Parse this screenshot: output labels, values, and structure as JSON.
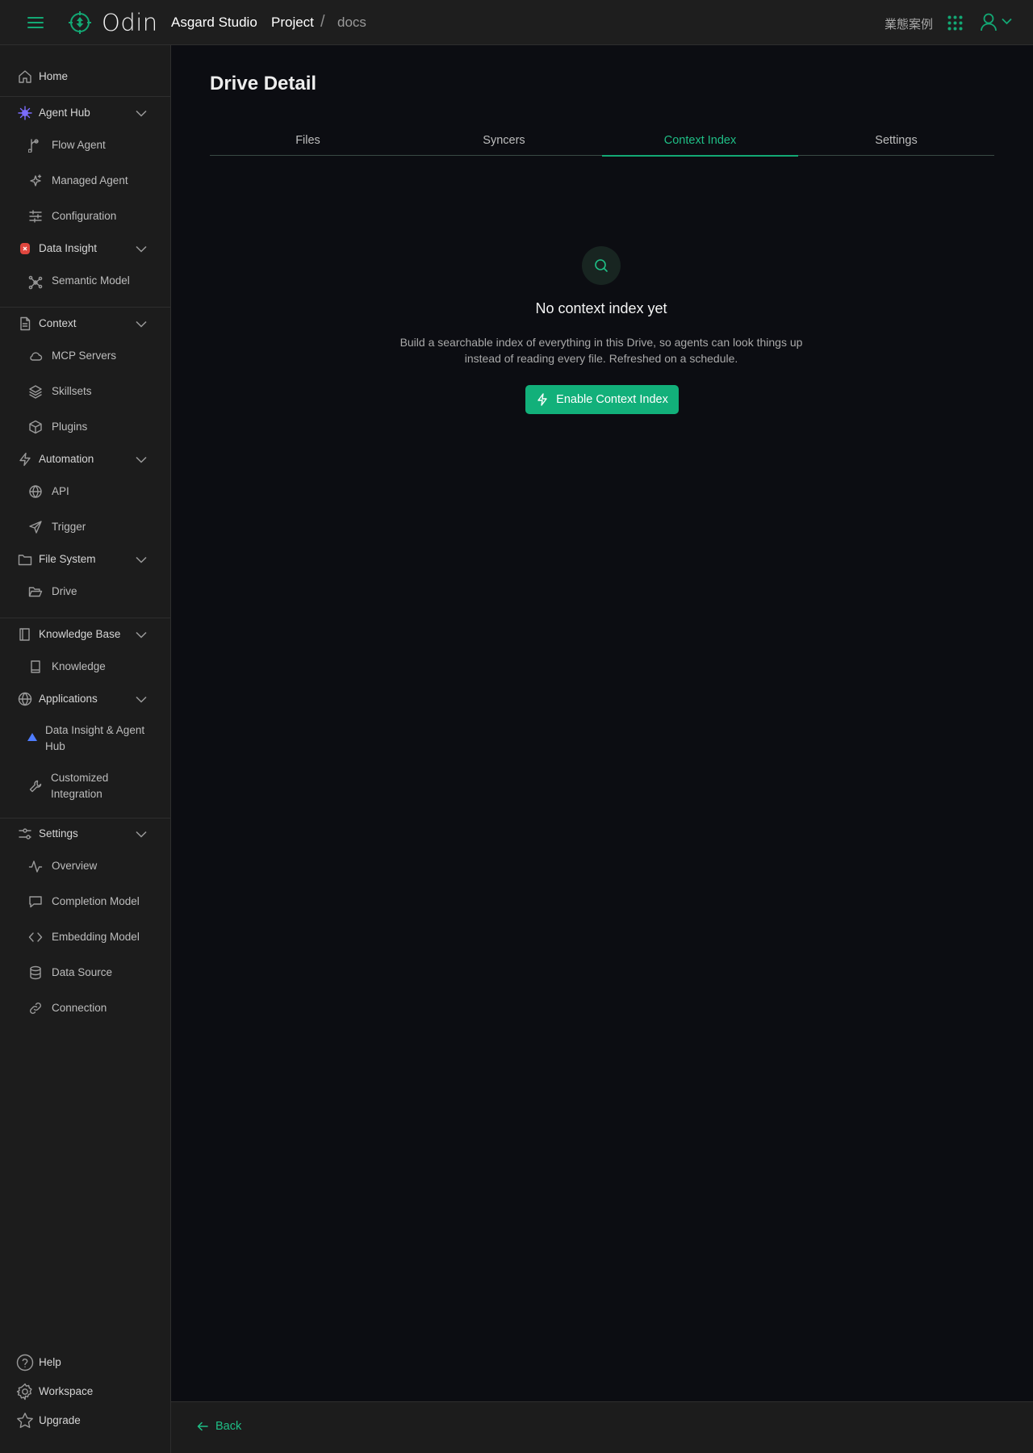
{
  "header": {
    "logo_text": "Odin",
    "studio": "Asgard Studio",
    "breadcrumb": {
      "project": "Project",
      "separator": "/",
      "current": "docs"
    },
    "link": "業態案例",
    "accent": "#13a874"
  },
  "sidebar": {
    "home": "Home",
    "agent_hub": "Agent Hub",
    "flow_agent": "Flow Agent",
    "managed_agent": "Managed Agent",
    "configuration": "Configuration",
    "data_insight": "Data Insight",
    "semantic_model": "Semantic Model",
    "context": "Context",
    "mcp_servers": "MCP Servers",
    "skillsets": "Skillsets",
    "plugins": "Plugins",
    "automation": "Automation",
    "api": "API",
    "trigger": "Trigger",
    "file_system": "File System",
    "drive": "Drive",
    "knowledge_base": "Knowledge Base",
    "knowledge": "Knowledge",
    "applications": "Applications",
    "data_insight_agent_hub_1": "Data Insight & Agent",
    "data_insight_agent_hub_2": "Hub",
    "customized_integration_1": "Customized",
    "customized_integration_2": "Integration",
    "settings": "Settings",
    "overview": "Overview",
    "completion_model": "Completion Model",
    "embedding_model": "Embedding Model",
    "data_source": "Data Source",
    "connection": "Connection",
    "help": "Help",
    "workspace": "Workspace",
    "upgrade": "Upgrade"
  },
  "main": {
    "title": "Drive Detail",
    "tabs": [
      "Files",
      "Syncers",
      "Context Index",
      "Settings"
    ],
    "active_tab": "Context Index",
    "empty": {
      "title": "No context index yet",
      "desc_line1": "Build a searchable index of everything in this Drive, so agents can look things up",
      "desc_line2": "instead of reading every file. Refreshed on a schedule.",
      "button": "Enable Context Index"
    }
  },
  "footer": {
    "back": "Back"
  }
}
